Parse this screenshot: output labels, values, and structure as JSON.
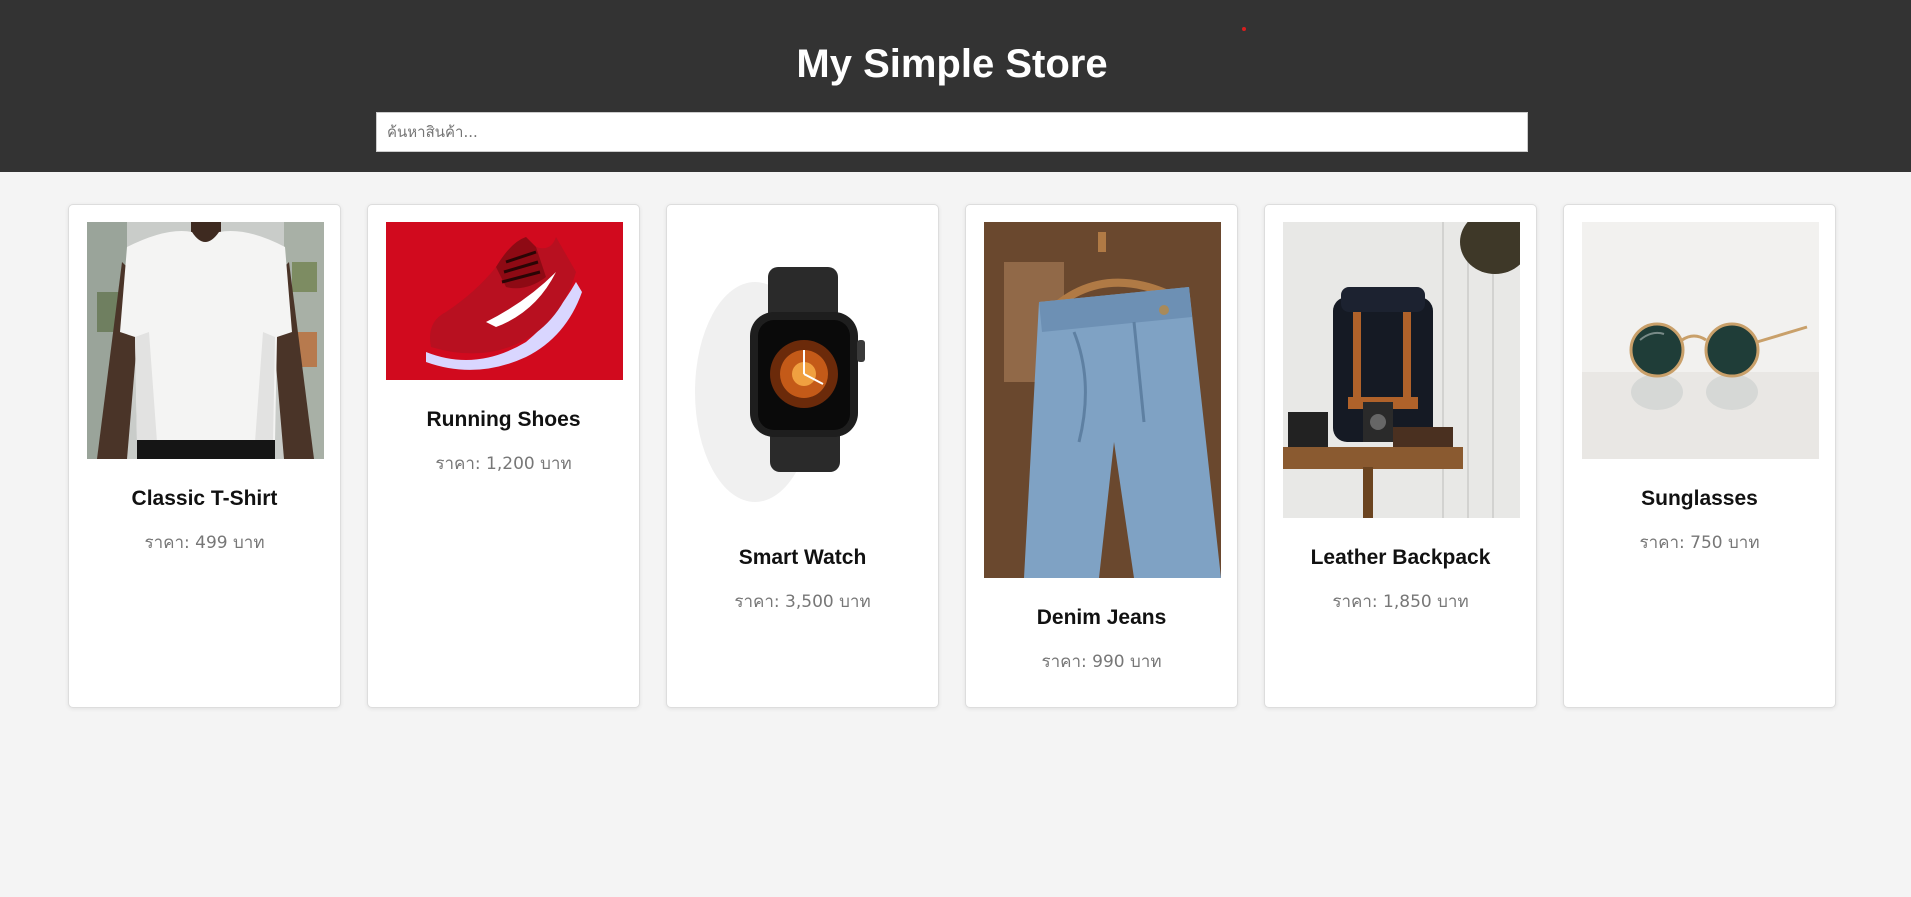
{
  "header": {
    "title": "My Simple Store",
    "accent_dot_color": "#d81e1e"
  },
  "search": {
    "placeholder": "ค้นหาสินค้า...",
    "value": ""
  },
  "products": [
    {
      "name": "Classic T-Shirt",
      "price": "ราคา: 499 บาท",
      "image": "white-tshirt-photo"
    },
    {
      "name": "Running Shoes",
      "price": "ราคา: 1,200 บาท",
      "image": "red-running-shoe-photo"
    },
    {
      "name": "Smart Watch",
      "price": "ราคา: 3,500 บาท",
      "image": "smart-watch-photo"
    },
    {
      "name": "Denim Jeans",
      "price": "ราคา: 990 บาท",
      "image": "denim-jeans-photo"
    },
    {
      "name": "Leather Backpack",
      "price": "ราคา: 1,850 บาท",
      "image": "leather-backpack-photo"
    },
    {
      "name": "Sunglasses",
      "price": "ราคา: 750 บาท",
      "image": "sunglasses-photo"
    }
  ]
}
